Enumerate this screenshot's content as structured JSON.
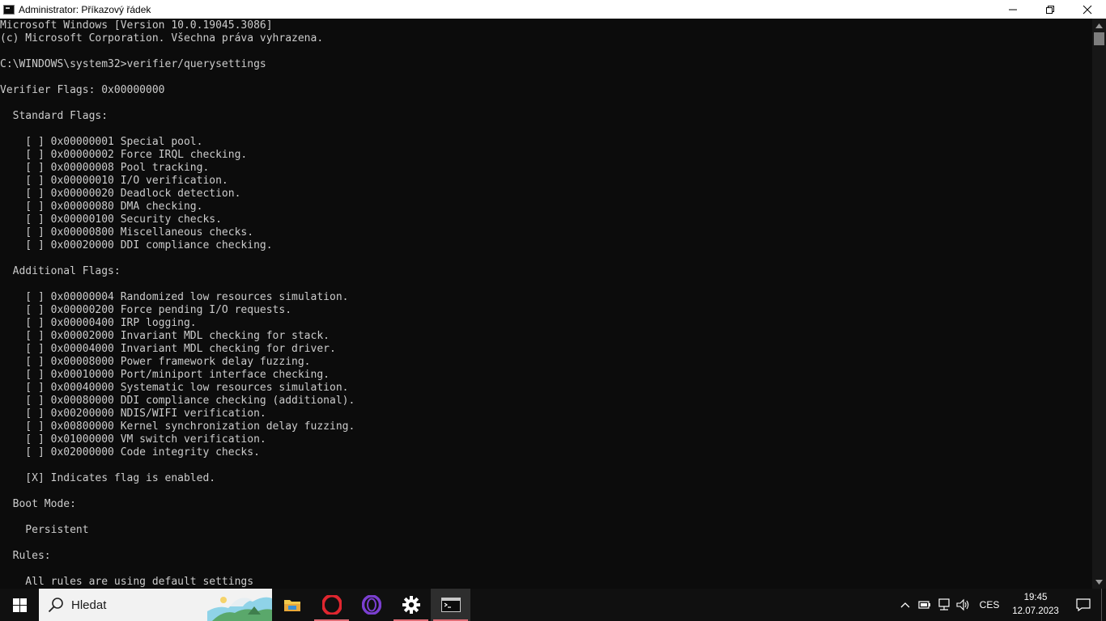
{
  "window": {
    "title": "Administrator: Příkazový řádek"
  },
  "console": {
    "lines": [
      "Microsoft Windows [Version 10.0.19045.3086]",
      "(c) Microsoft Corporation. Všechna práva vyhrazena.",
      "",
      "C:\\WINDOWS\\system32>verifier/querysettings",
      "",
      "Verifier Flags: 0x00000000",
      "",
      "  Standard Flags:",
      "",
      "    [ ] 0x00000001 Special pool.",
      "    [ ] 0x00000002 Force IRQL checking.",
      "    [ ] 0x00000008 Pool tracking.",
      "    [ ] 0x00000010 I/O verification.",
      "    [ ] 0x00000020 Deadlock detection.",
      "    [ ] 0x00000080 DMA checking.",
      "    [ ] 0x00000100 Security checks.",
      "    [ ] 0x00000800 Miscellaneous checks.",
      "    [ ] 0x00020000 DDI compliance checking.",
      "",
      "  Additional Flags:",
      "",
      "    [ ] 0x00000004 Randomized low resources simulation.",
      "    [ ] 0x00000200 Force pending I/O requests.",
      "    [ ] 0x00000400 IRP logging.",
      "    [ ] 0x00002000 Invariant MDL checking for stack.",
      "    [ ] 0x00004000 Invariant MDL checking for driver.",
      "    [ ] 0x00008000 Power framework delay fuzzing.",
      "    [ ] 0x00010000 Port/miniport interface checking.",
      "    [ ] 0x00040000 Systematic low resources simulation.",
      "    [ ] 0x00080000 DDI compliance checking (additional).",
      "    [ ] 0x00200000 NDIS/WIFI verification.",
      "    [ ] 0x00800000 Kernel synchronization delay fuzzing.",
      "    [ ] 0x01000000 VM switch verification.",
      "    [ ] 0x02000000 Code integrity checks.",
      "",
      "    [X] Indicates flag is enabled.",
      "",
      "  Boot Mode:",
      "",
      "    Persistent",
      "",
      "  Rules:",
      "",
      "    All rules are using default settings"
    ]
  },
  "taskbar": {
    "search_placeholder": "Hledat",
    "apps": [
      {
        "icon": "file-explorer-icon",
        "accent": "#f2c94c"
      },
      {
        "icon": "opera-icon",
        "accent": "#d9252c"
      },
      {
        "icon": "opera-gx-icon",
        "accent": "#7b3fd1"
      },
      {
        "icon": "settings-gear-icon",
        "accent": "#ffffff"
      },
      {
        "icon": "command-prompt-icon",
        "accent": "#ffffff"
      }
    ],
    "language": "CES",
    "time": "19:45",
    "date": "12.07.2023"
  },
  "colors": {
    "console_bg": "#0c0c0c",
    "console_text": "#cccccc",
    "taskbar_bg": "#101010",
    "active_underline": "#e06c75"
  }
}
